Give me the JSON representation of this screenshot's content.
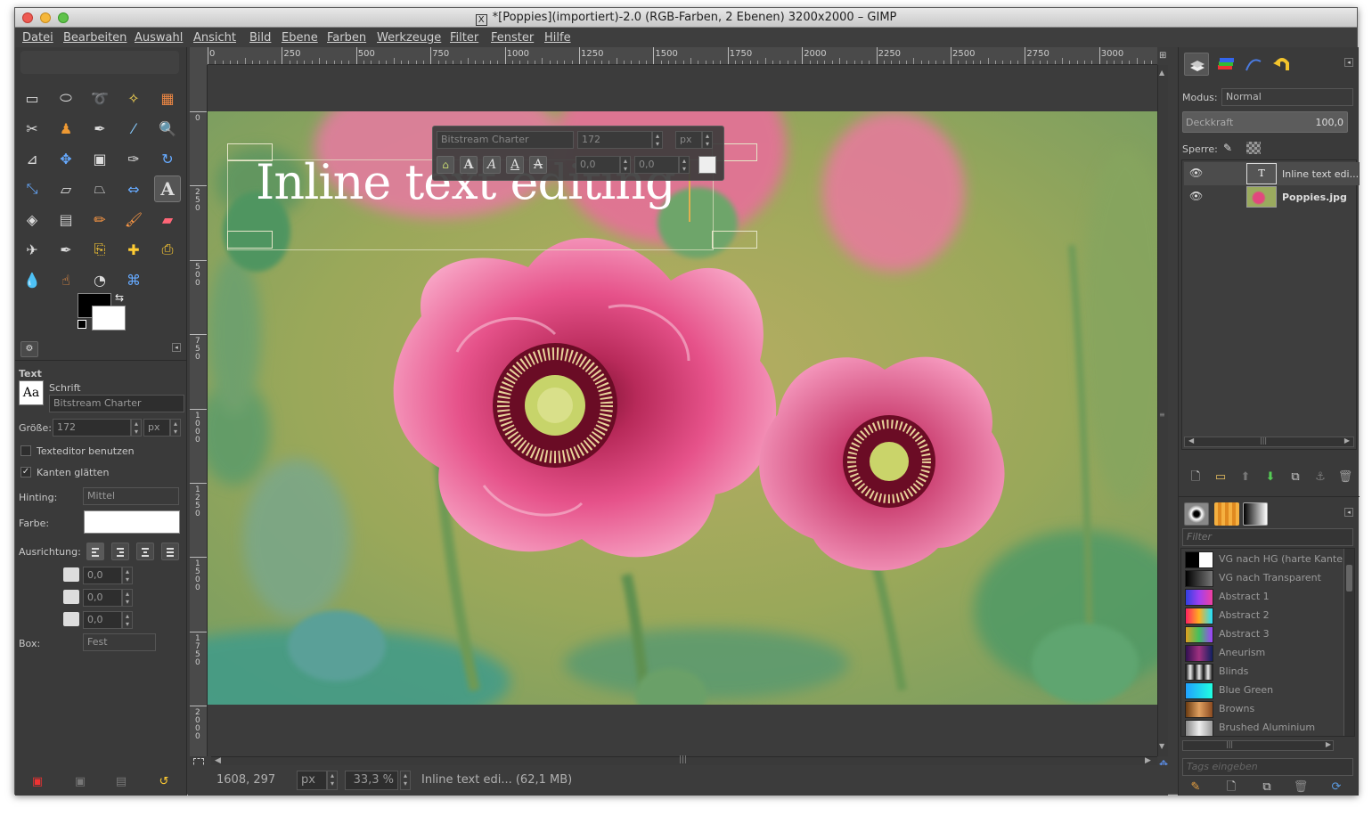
{
  "window": {
    "title": "*[Poppies](importiert)-2.0 (RGB-Farben, 2 Ebenen) 3200x2000 – GIMP"
  },
  "menu": [
    "Datei",
    "Bearbeiten",
    "Auswahl",
    "Ansicht",
    "Bild",
    "Ebene",
    "Farben",
    "Werkzeuge",
    "Filter",
    "Fenster",
    "Hilfe"
  ],
  "toolbox": {
    "tools": [
      "rect-select",
      "ellipse-select",
      "free-select",
      "fuzzy-select",
      "select-by-color",
      "scissors",
      "foreground-select",
      "paths",
      "color-picker",
      "zoom",
      "measure",
      "move",
      "align",
      "crop",
      "rotate",
      "scale",
      "shear",
      "perspective",
      "flip",
      "text",
      "bucket-fill",
      "blend",
      "pencil",
      "paintbrush",
      "eraser",
      "airbrush",
      "ink",
      "clone",
      "heal",
      "perspective-clone",
      "convolve",
      "smudge",
      "dodge-burn",
      "cage"
    ]
  },
  "tool_options": {
    "section_title": "Text",
    "font_label": "Schrift",
    "font_preview": "Aa",
    "font_value": "Bitstream Charter",
    "size_label": "Größe:",
    "size_value": "172",
    "size_unit": "px",
    "use_editor_label": "Texteditor benutzen",
    "use_editor_checked": false,
    "antialias_label": "Kanten glätten",
    "antialias_checked": true,
    "hinting_label": "Hinting:",
    "hinting_value": "Mittel",
    "color_label": "Farbe:",
    "justify_label": "Ausrichtung:",
    "indent_value": "0,0",
    "line_spacing_value": "0,0",
    "letter_spacing_value": "0,0",
    "box_label": "Box:",
    "box_value": "Fest",
    "check_mark": "✓"
  },
  "on_canvas_editor": {
    "font": "Bitstream Charter",
    "size": "172",
    "unit": "px",
    "baseline": "0,0",
    "kerning": "0,0",
    "style_buttons": [
      "A",
      "A",
      "A",
      "A"
    ]
  },
  "canvas": {
    "text_layer_content": "Inline text editing",
    "ruler_h": [
      "0",
      "250",
      "500",
      "750",
      "1000",
      "1250",
      "1500",
      "1750",
      "2000",
      "2250",
      "2500",
      "2750",
      "3000"
    ],
    "ruler_v": [
      "0",
      "2\n5\n0",
      "5\n0\n0",
      "7\n5\n0",
      "1\n0\n0\n0",
      "1\n2\n5\n0",
      "1\n5\n0\n0",
      "1\n7\n5\n0",
      "2\n0\n0\n0"
    ]
  },
  "status": {
    "coords": "1608, 297",
    "unit": "px",
    "zoom": "33,3 %",
    "info": "Inline text edi... (62,1 MB)"
  },
  "layers_dock": {
    "mode_label": "Modus:",
    "mode_value": "Normal",
    "opacity_label": "Deckkraft",
    "opacity_value": "100,0",
    "lock_label": "Sperre:",
    "layers": [
      {
        "name": "Inline text edi...",
        "visible": true,
        "bold": false
      },
      {
        "name": "Poppies.jpg",
        "visible": true,
        "bold": true
      }
    ]
  },
  "gradients_dock": {
    "filter_placeholder": "Filter",
    "tags_placeholder": "Tags eingeben",
    "items": [
      {
        "name": "VG nach HG (harte Kante)",
        "swatch": "linear-gradient(90deg,#000 50%,#fff 50%)"
      },
      {
        "name": "VG nach Transparent",
        "swatch": "linear-gradient(90deg,#000,#777)"
      },
      {
        "name": "Abstract 1",
        "swatch": "linear-gradient(90deg,#3040e0,#a040f0,#f040a0)"
      },
      {
        "name": "Abstract 2",
        "swatch": "linear-gradient(90deg,#ff2060,#ffb020,#20e0ff)"
      },
      {
        "name": "Abstract 3",
        "swatch": "linear-gradient(90deg,#e0a020,#40c060,#a040ff)"
      },
      {
        "name": "Aneurism",
        "swatch": "linear-gradient(90deg,#301050,#a03080,#102060)"
      },
      {
        "name": "Blinds",
        "swatch": "repeating-linear-gradient(90deg,#111 0,#eee 5px,#111 10px)"
      },
      {
        "name": "Blue Green",
        "swatch": "linear-gradient(90deg,#20a0ff,#20ffe0)"
      },
      {
        "name": "Browns",
        "swatch": "linear-gradient(90deg,#6a3a10,#e0a060,#8a4a20)"
      },
      {
        "name": "Brushed Aluminium",
        "swatch": "linear-gradient(90deg,#888,#eee,#999)"
      }
    ]
  }
}
